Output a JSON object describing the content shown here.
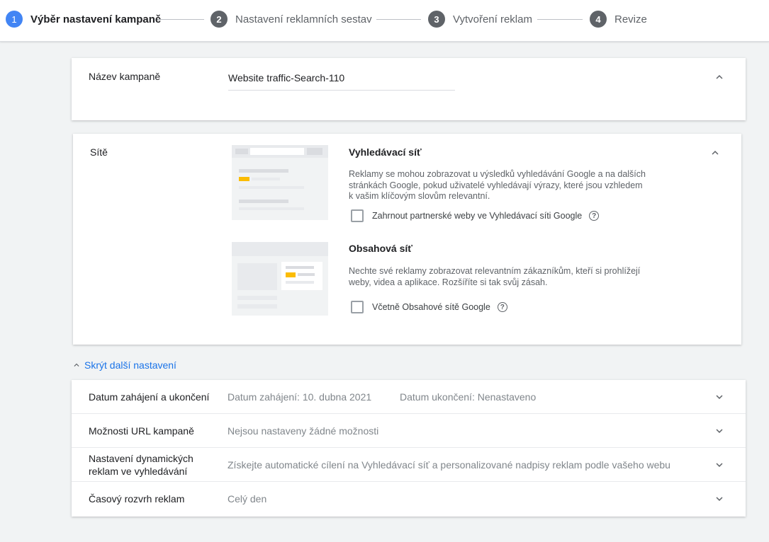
{
  "stepper": {
    "steps": [
      {
        "num": "1",
        "label": "Výběr nastavení kampaně"
      },
      {
        "num": "2",
        "label": "Nastavení reklamních sestav"
      },
      {
        "num": "3",
        "label": "Vytvoření reklam"
      },
      {
        "num": "4",
        "label": "Revize"
      }
    ]
  },
  "campaign_name": {
    "label": "Název kampaně",
    "value": "Website traffic-Search-110"
  },
  "networks": {
    "label": "Sítě",
    "search": {
      "title": "Vyhledávací síť",
      "desc_lines": [
        "Reklamy se mohou zobrazovat u výsledků vyhledávání Google a na dalších",
        "stránkách Google, pokud uživatelé vyhledávají výrazy, které jsou vzhledem",
        "k vašim klíčovým slovům relevantní."
      ],
      "checkbox_label": "Zahrnout partnerské weby ve Vyhledávací síti Google"
    },
    "display": {
      "title": "Obsahová síť",
      "desc_lines": [
        "Nechte své reklamy zobrazovat relevantním zákazníkům, kteří si prohlížejí",
        "weby, videa a aplikace. Rozšíříte si tak svůj zásah."
      ],
      "checkbox_label": "Včetně Obsahové sítě Google"
    },
    "help_glyph": "?"
  },
  "more_settings": {
    "link_label": "Skrýt další nastavení",
    "rows": [
      {
        "label_lines": [
          "Datum zahájení a ukončení"
        ],
        "value": "Datum zahájení: 10. dubna 2021",
        "value2": "Datum ukončení: Nenastaveno"
      },
      {
        "label_lines": [
          "Možnosti URL kampaně"
        ],
        "value": "Nejsou nastaveny žádné možnosti",
        "value2": ""
      },
      {
        "label_lines": [
          "Nastavení dynamických",
          "reklam ve vyhledávání"
        ],
        "value": "Získejte automatické cílení na Vyhledávací síť a personalizované nadpisy reklam podle vašeho webu",
        "value2": ""
      },
      {
        "label_lines": [
          "Časový rozvrh reklam"
        ],
        "value": "Celý den",
        "value2": ""
      }
    ]
  },
  "colors": {
    "accent": "#1a73e8",
    "active_step": "#4285f4",
    "ad_yellow": "#fbbc04"
  },
  "icons": [
    "chevron-up-icon",
    "chevron-down-icon",
    "help-icon",
    "checkbox-icon"
  ]
}
